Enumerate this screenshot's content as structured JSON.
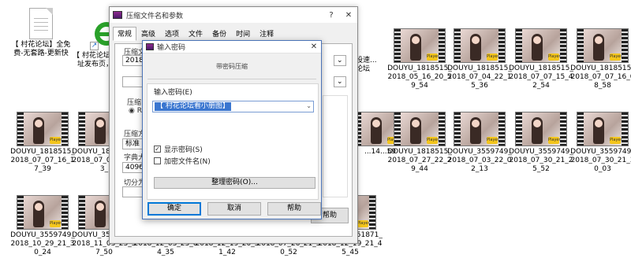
{
  "desktop_files": [
    {
      "kind": "doc",
      "label": "【 村花论坛】全免费-无套路-更新快"
    },
    {
      "kind": "ie",
      "label": "【 村花论坛】最新地址发布页，此打开"
    },
    {
      "kind": "doc",
      "label": "...设速...论坛"
    },
    {
      "kind": "video",
      "label": "DOUYU_1818515_2018_05_16_20_59_54"
    },
    {
      "kind": "video",
      "label": "DOUYU_1818515_2018_07_04_22_15_36"
    },
    {
      "kind": "video",
      "label": "DOUYU_1818515_2018_07_07_15_42_54"
    },
    {
      "kind": "video",
      "label": "DOUYU_1818515_2018_07_07_16_08_58"
    },
    {
      "kind": "video",
      "label": "DOUYU_1818515_2018_07_07_16_17_39"
    },
    {
      "kind": "video",
      "label": "DOUYU_1818515_2018_07_07_17_13_"
    },
    {
      "kind": "video",
      "label": "...14...59"
    },
    {
      "kind": "video",
      "label": "DOUYU_1818515_2018_07_27_22_29_44"
    },
    {
      "kind": "video",
      "label": "DOUYU_3559749_2018_07_03_22_02_13"
    },
    {
      "kind": "video",
      "label": "DOUYU_3559749_2018_07_30_21_25_52"
    },
    {
      "kind": "video",
      "label": "DOUYU_3559749_2018_07_30_21_30_03"
    },
    {
      "kind": "video",
      "label": "DOUYU_3559749_2018_10_29_21_30_24"
    },
    {
      "kind": "video",
      "label": "DOUYU_3559749_2018_11_03_23_57_50"
    },
    {
      "kind": "video",
      "label": "DOUYU_3559749_2018_12_03_23_04_35"
    },
    {
      "kind": "video",
      "label": "DOUYU_4632993_2018_12_19_20_51_42"
    },
    {
      "kind": "video",
      "label": "DOUYU_4946084_2018_07_26_21_50_52"
    },
    {
      "kind": "video",
      "label": "DOUYU_5551871_2018_12_19_21_45_45"
    }
  ],
  "back_dialog": {
    "title": "压缩文件名和参数",
    "help_label": "?",
    "close_label": "✕",
    "tabs": [
      "常规",
      "高级",
      "选项",
      "文件",
      "备份",
      "时间",
      "注释"
    ],
    "archive_label": "压缩文",
    "archive_value": "2018.",
    "compress_label": "压缩",
    "radio_label": "RA",
    "method_label": "压缩方",
    "method_value": "标准",
    "dict_label": "字典大",
    "dict_value": "4096",
    "split_label": "切分为",
    "right_btn_label": "帮助"
  },
  "front_dialog": {
    "title": "输入密码",
    "close_label": "✕",
    "heading": "带密码压缩",
    "password_label": "输入密码(E)",
    "password_value": "【 村花论坛看小册图】",
    "show_password_label": "显示密码(S)",
    "show_password_checked": true,
    "encrypt_names_label": "加密文件名(N)",
    "encrypt_names_checked": false,
    "manage_label": "整理密码(O)...",
    "ok_label": "确定",
    "cancel_label": "取消",
    "help_label": "帮助"
  }
}
